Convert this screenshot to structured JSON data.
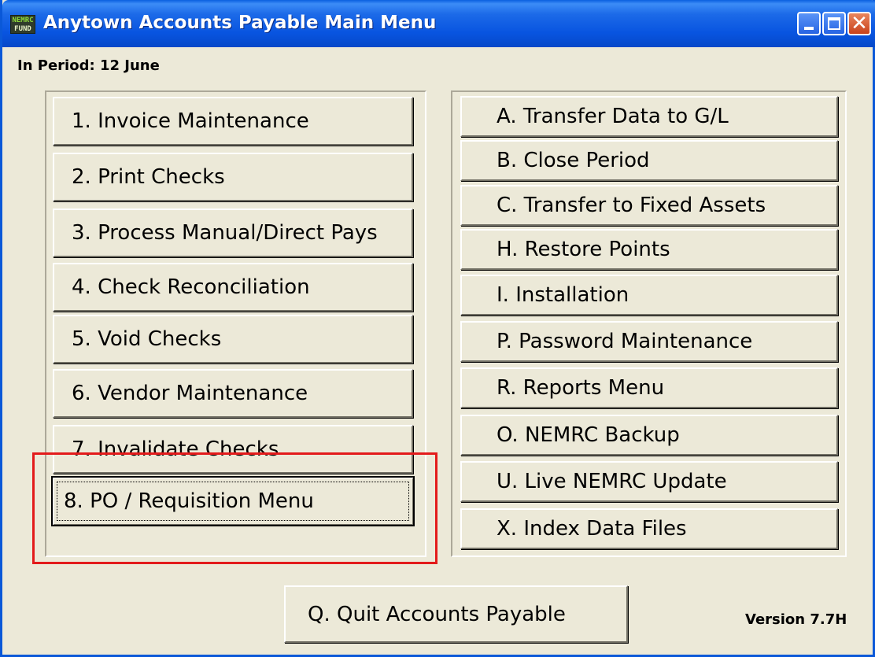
{
  "window": {
    "icon_top": "NEMRC",
    "icon_bottom": "FUND",
    "title": "Anytown Accounts Payable  Main Menu"
  },
  "period": "In Period: 12 June",
  "left_menu": [
    {
      "label": "1.  Invoice Maintenance"
    },
    {
      "label": "2. Print Checks"
    },
    {
      "label": "3. Process Manual/Direct Pays"
    },
    {
      "label": "4. Check Reconciliation"
    },
    {
      "label": "5. Void Checks"
    },
    {
      "label": "6. Vendor Maintenance"
    },
    {
      "label": "7. Invalidate Checks"
    },
    {
      "label": "8. PO / Requisition Menu"
    }
  ],
  "right_menu": [
    {
      "label": "A. Transfer Data to G/L"
    },
    {
      "label": "B. Close Period"
    },
    {
      "label": "C. Transfer to Fixed Assets"
    },
    {
      "label": "H. Restore Points"
    },
    {
      "label": "I.  Installation"
    },
    {
      "label": "P.  Password Maintenance"
    },
    {
      "label": "R.  Reports Menu"
    },
    {
      "label": "O. NEMRC Backup"
    },
    {
      "label": "U. Live NEMRC Update"
    },
    {
      "label": "X.  Index Data Files"
    }
  ],
  "quit": {
    "label": "Q. Quit Accounts Payable"
  },
  "version": "Version 7.7H",
  "colors": {
    "highlight": "#e31b1b",
    "titlebar": "#0854e0",
    "window_bg": "#ece9d8"
  }
}
